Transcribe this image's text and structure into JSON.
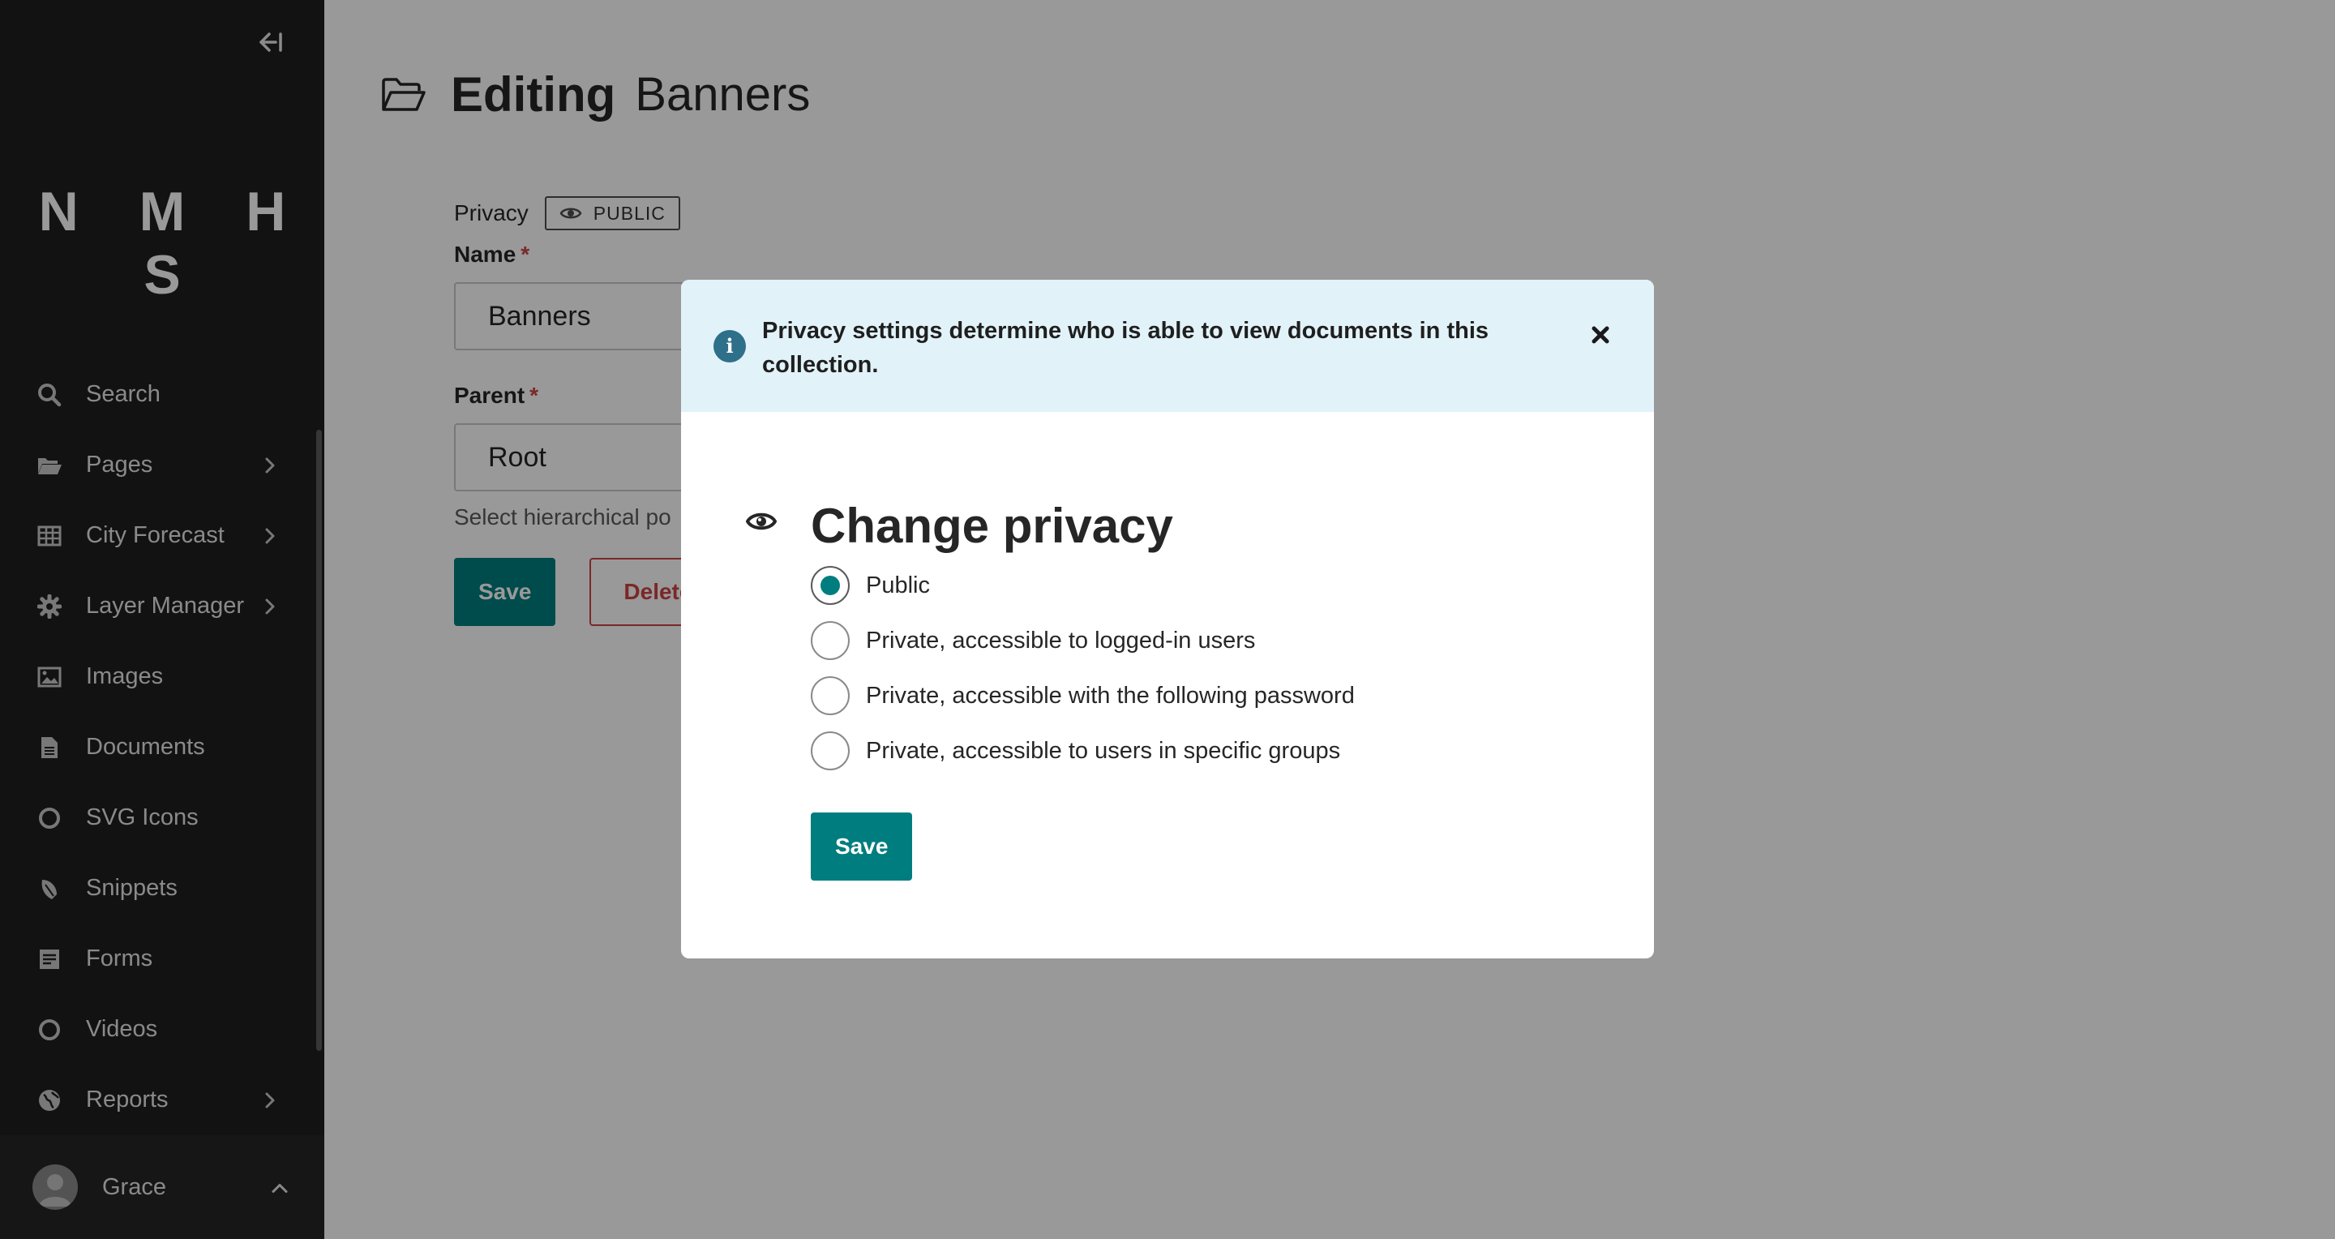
{
  "sidebar": {
    "logo": "N M H S",
    "items": [
      {
        "label": "Search",
        "icon": "search-icon",
        "has_submenu": false
      },
      {
        "label": "Pages",
        "icon": "folder-open-icon",
        "has_submenu": true
      },
      {
        "label": "City Forecast",
        "icon": "table-icon",
        "has_submenu": true
      },
      {
        "label": "Layer Manager",
        "icon": "gear-icon",
        "has_submenu": true
      },
      {
        "label": "Images",
        "icon": "image-icon",
        "has_submenu": false
      },
      {
        "label": "Documents",
        "icon": "document-icon",
        "has_submenu": false
      },
      {
        "label": "SVG Icons",
        "icon": "circle-icon",
        "has_submenu": false
      },
      {
        "label": "Snippets",
        "icon": "snippet-icon",
        "has_submenu": false
      },
      {
        "label": "Forms",
        "icon": "form-icon",
        "has_submenu": false
      },
      {
        "label": "Videos",
        "icon": "circle-icon",
        "has_submenu": false
      },
      {
        "label": "Reports",
        "icon": "globe-icon",
        "has_submenu": true
      }
    ],
    "account": {
      "name": "Grace"
    }
  },
  "header": {
    "title_strong": "Editing",
    "title": "Banners"
  },
  "form": {
    "privacy_label": "Privacy",
    "privacy_badge": "PUBLIC",
    "name_label": "Name",
    "name_required": "*",
    "name_value": "Banners",
    "parent_label": "Parent",
    "parent_required": "*",
    "parent_value": "Root",
    "parent_help": "Select hierarchical po",
    "save_label": "Save",
    "delete_label": "Delete"
  },
  "modal": {
    "help_text": "Privacy settings determine who is able to view documents in this collection.",
    "title": "Change privacy",
    "options": [
      {
        "label": "Public",
        "checked": true
      },
      {
        "label": "Private, accessible to logged-in users",
        "checked": false
      },
      {
        "label": "Private, accessible with the following password",
        "checked": false
      },
      {
        "label": "Private, accessible to users in specific groups",
        "checked": false
      }
    ],
    "save_label": "Save"
  },
  "colors": {
    "primary": "#007d7e",
    "danger": "#cd4444",
    "sidebar_bg": "#1e1e1e",
    "help_bg": "#e2f2f9",
    "info_icon": "#2e6f8a"
  }
}
